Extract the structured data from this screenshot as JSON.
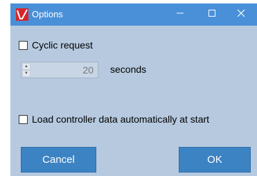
{
  "window": {
    "title": "Options",
    "icon": "app-logo-icon",
    "controls": {
      "minimize": "minimize-icon",
      "maximize": "maximize-icon",
      "close": "close-icon"
    }
  },
  "cyclic_request": {
    "label": "Cyclic request",
    "checked": false
  },
  "interval": {
    "value": "20",
    "unit": "seconds",
    "enabled": false
  },
  "load_on_start": {
    "label": "Load controller data automatically at start",
    "checked": false
  },
  "buttons": {
    "cancel": "Cancel",
    "ok": "OK"
  },
  "colors": {
    "titlebar": "#4a90d9",
    "background": "#b6c9df",
    "button": "#3c83c3",
    "logo": "#d6262b"
  }
}
